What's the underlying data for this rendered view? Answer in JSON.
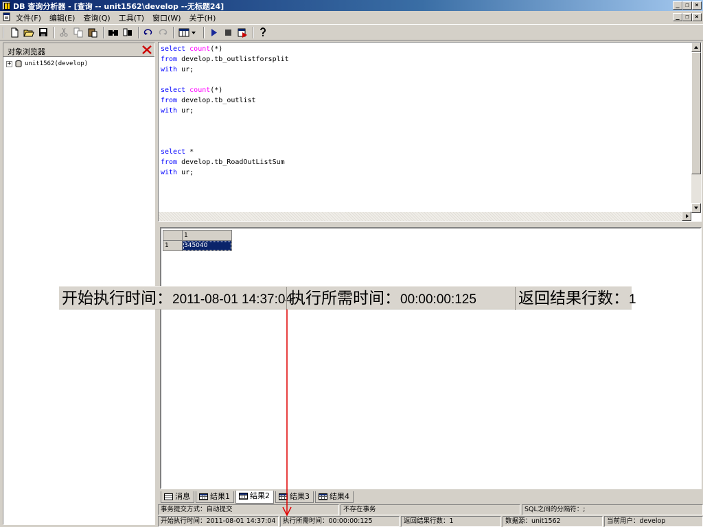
{
  "window": {
    "title": "DB 查询分析器 - [查询 -- unit1562\\develop --无标题24]",
    "controls": [
      "_",
      "❐",
      "×"
    ]
  },
  "menu": {
    "items": [
      "文件(F)",
      "编辑(E)",
      "查询(Q)",
      "工具(T)",
      "窗口(W)",
      "关于(H)"
    ]
  },
  "object_browser": {
    "title": "对象浏览器",
    "tree_root": "unit1562(develop)",
    "expander": "+"
  },
  "editor": {
    "lines": [
      [
        {
          "t": "select ",
          "k": "kw"
        },
        {
          "t": "count",
          "k": "fn"
        },
        {
          "t": "(*)",
          "k": ""
        }
      ],
      [
        {
          "t": "from",
          "k": "kw"
        },
        {
          "t": " develop.tb_outlistforsplit",
          "k": ""
        }
      ],
      [
        {
          "t": "with",
          "k": "kw"
        },
        {
          "t": " ur;",
          "k": ""
        }
      ],
      [],
      [
        {
          "t": "select ",
          "k": "kw"
        },
        {
          "t": "count",
          "k": "fn"
        },
        {
          "t": "(*)",
          "k": ""
        }
      ],
      [
        {
          "t": "from",
          "k": "kw"
        },
        {
          "t": " develop.tb_outlist",
          "k": ""
        }
      ],
      [
        {
          "t": "with",
          "k": "kw"
        },
        {
          "t": " ur;",
          "k": ""
        }
      ],
      [],
      [],
      [],
      [
        {
          "t": "select",
          "k": "kw"
        },
        {
          "t": " *",
          "k": ""
        }
      ],
      [
        {
          "t": "from",
          "k": "kw"
        },
        {
          "t": " develop.tb_RoadOutListSum",
          "k": ""
        }
      ],
      [
        {
          "t": "with",
          "k": "kw"
        },
        {
          "t": " ur;",
          "k": ""
        }
      ]
    ]
  },
  "results": {
    "column_header": "1",
    "row_header": "1",
    "value": "345040"
  },
  "tabs": [
    {
      "label": "消息",
      "icon": "message-icon",
      "active": false
    },
    {
      "label": "结果1",
      "icon": "grid-icon",
      "active": false
    },
    {
      "label": "结果2",
      "icon": "grid-icon",
      "active": true
    },
    {
      "label": "结果3",
      "icon": "grid-icon",
      "active": false
    },
    {
      "label": "结果4",
      "icon": "grid-icon",
      "active": false
    }
  ],
  "status": {
    "commit_mode": "事务提交方式：自动提交",
    "transaction": "不存在事务",
    "separator": "SQL之间的分隔符：;",
    "start_time": "开始执行时间：2011-08-01 14:37:04",
    "elapsed": "执行所需时间：00:00:00:125",
    "rows": "返回结果行数：1",
    "datasource": "数据源：unit1562",
    "user": "当前用户：develop"
  },
  "callout": {
    "start_label": "开始执行时间：",
    "start_value": "2011-08-01 14:37:04",
    "elapsed_label": "执行所需时间：",
    "elapsed_value": "00:00:00:125",
    "rows_label": "返回结果行数：",
    "rows_value": "1",
    "arrow_color": "#e00000"
  }
}
